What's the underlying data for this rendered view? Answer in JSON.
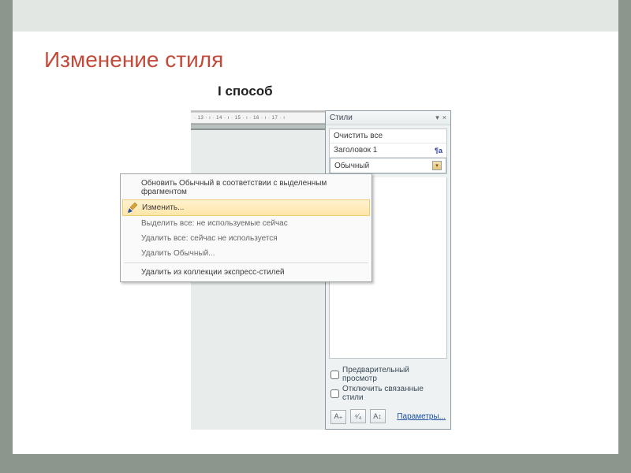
{
  "slide": {
    "title": "Изменение стиля",
    "subtitle": "I способ"
  },
  "ruler_text": "· 13 · ı · 14 · ı · 15 · ı · 16 · ı · 17 · ı",
  "styles_pane": {
    "header": "Стили",
    "items": [
      {
        "label": "Очистить все",
        "mark": ""
      },
      {
        "label": "Заголовок 1",
        "mark": "¶a"
      },
      {
        "label": "Обычный",
        "mark": "",
        "selected": true
      }
    ],
    "preview_label": "Предварительный просмотр",
    "linked_label": "Отключить связанные стили",
    "params_label": "Параметры..."
  },
  "context_menu": {
    "items": [
      {
        "label": "Обновить Обычный в соответствии с выделенным фрагментом",
        "enabled": true
      },
      {
        "label": "Изменить...",
        "enabled": true,
        "active": true
      },
      {
        "label": "Выделить все: не используемые сейчас",
        "enabled": false
      },
      {
        "label": "Удалить все: сейчас не используется",
        "enabled": false
      },
      {
        "label": "Удалить Обычный...",
        "enabled": false
      },
      {
        "label": "Удалить из коллекции экспресс-стилей",
        "enabled": true
      }
    ]
  }
}
